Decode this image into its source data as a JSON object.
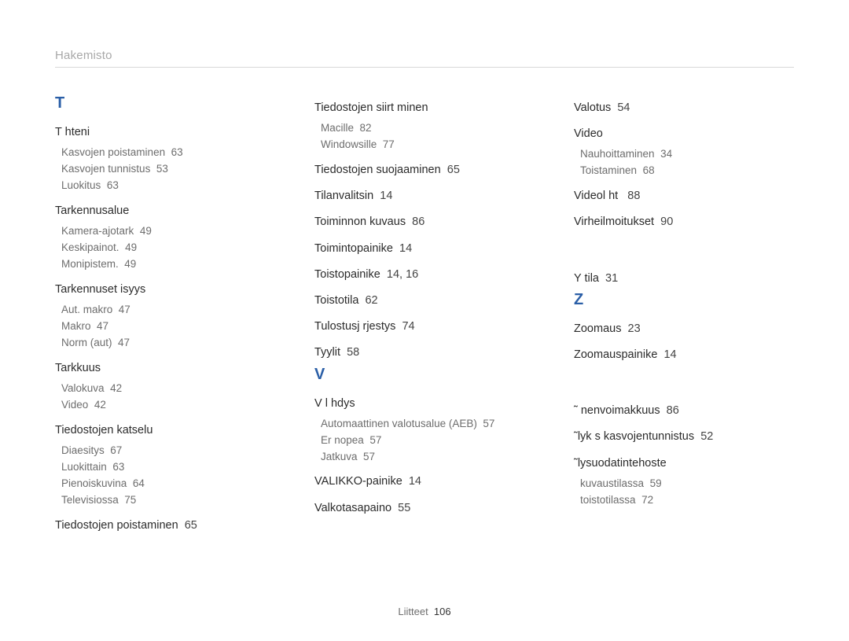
{
  "header": "Hakemisto",
  "footer_label": "Liitteet",
  "footer_page": "106",
  "columns": [
    [
      {
        "type": "letter",
        "text": "T"
      },
      {
        "type": "main",
        "label": "T hteni",
        "page": "",
        "subs": [
          {
            "label": "Kasvojen poistaminen",
            "page": "63"
          },
          {
            "label": "Kasvojen tunnistus",
            "page": "53"
          },
          {
            "label": "Luokitus",
            "page": "63"
          }
        ]
      },
      {
        "type": "main",
        "label": "Tarkennusalue",
        "page": "",
        "subs": [
          {
            "label": "Kamera-ajotark",
            "page": "49"
          },
          {
            "label": "Keskipainot.",
            "page": "49"
          },
          {
            "label": "Monipistem.",
            "page": "49"
          }
        ]
      },
      {
        "type": "main",
        "label": "Tarkennuset isyys",
        "page": "",
        "subs": [
          {
            "label": "Aut. makro",
            "page": "47"
          },
          {
            "label": "Makro",
            "page": "47"
          },
          {
            "label": "Norm (aut)",
            "page": "47"
          }
        ]
      },
      {
        "type": "main",
        "label": "Tarkkuus",
        "page": "",
        "subs": [
          {
            "label": "Valokuva",
            "page": "42"
          },
          {
            "label": "Video",
            "page": "42"
          }
        ]
      },
      {
        "type": "main",
        "label": "Tiedostojen katselu",
        "page": "",
        "subs": [
          {
            "label": "Diaesitys",
            "page": "67"
          },
          {
            "label": "Luokittain",
            "page": "63"
          },
          {
            "label": "Pienoiskuvina",
            "page": "64"
          },
          {
            "label": "Televisiossa",
            "page": "75"
          }
        ]
      },
      {
        "type": "main",
        "label": "Tiedostojen poistaminen",
        "page": "65",
        "subs": []
      }
    ],
    [
      {
        "type": "main",
        "label": "Tiedostojen siirt minen",
        "page": "",
        "subs": [
          {
            "label": "Macille",
            "page": "82"
          },
          {
            "label": "Windowsille",
            "page": "77"
          }
        ]
      },
      {
        "type": "main",
        "label": "Tiedostojen suojaaminen",
        "page": "65",
        "subs": []
      },
      {
        "type": "main",
        "label": "Tilanvalitsin",
        "page": "14",
        "subs": []
      },
      {
        "type": "main",
        "label": "Toiminnon kuvaus",
        "page": "86",
        "subs": []
      },
      {
        "type": "main",
        "label": "Toimintopainike",
        "page": "14",
        "subs": []
      },
      {
        "type": "main",
        "label": "Toistopainike",
        "page": "14, 16",
        "subs": []
      },
      {
        "type": "main",
        "label": "Toistotila",
        "page": "62",
        "subs": []
      },
      {
        "type": "main",
        "label": "Tulostusj rjestys",
        "page": "74",
        "subs": []
      },
      {
        "type": "main",
        "label": "Tyylit",
        "page": "58",
        "subs": []
      },
      {
        "type": "letter",
        "text": "V"
      },
      {
        "type": "main",
        "label": "V l hdys",
        "page": "",
        "subs": [
          {
            "label": "Automaattinen valotusalue (AEB)",
            "page": "57"
          },
          {
            "label": "Er nopea",
            "page": "57"
          },
          {
            "label": "Jatkuva",
            "page": "57"
          }
        ]
      },
      {
        "type": "main",
        "label": "VALIKKO-painike",
        "page": "14",
        "subs": []
      },
      {
        "type": "main",
        "label": "Valkotasapaino",
        "page": "55",
        "subs": []
      }
    ],
    [
      {
        "type": "main",
        "label": "Valotus",
        "page": "54",
        "subs": []
      },
      {
        "type": "main",
        "label": "Video",
        "page": "",
        "subs": [
          {
            "label": "Nauhoittaminen",
            "page": "34"
          },
          {
            "label": "Toistaminen",
            "page": "68"
          }
        ]
      },
      {
        "type": "main",
        "label": "Videol ht ",
        "page": "88",
        "subs": []
      },
      {
        "type": "main",
        "label": "Virheilmoitukset",
        "page": "90",
        "subs": []
      },
      {
        "type": "gap"
      },
      {
        "type": "main",
        "label": "Y tila",
        "page": "31",
        "subs": []
      },
      {
        "type": "letter",
        "text": "Z"
      },
      {
        "type": "main",
        "label": "Zoomaus",
        "page": "23",
        "subs": []
      },
      {
        "type": "main",
        "label": "Zoomauspainike",
        "page": "14",
        "subs": []
      },
      {
        "type": "gap"
      },
      {
        "type": "main",
        "label": "˜ nenvoimakkuus",
        "page": "86",
        "subs": []
      },
      {
        "type": "main",
        "label": "˜lyk s kasvojentunnistus",
        "page": "52",
        "subs": []
      },
      {
        "type": "main",
        "label": "˜lysuodatintehoste",
        "page": "",
        "subs": [
          {
            "label": "kuvaustilassa",
            "page": "59"
          },
          {
            "label": "toistotilassa",
            "page": "72"
          }
        ]
      }
    ]
  ]
}
